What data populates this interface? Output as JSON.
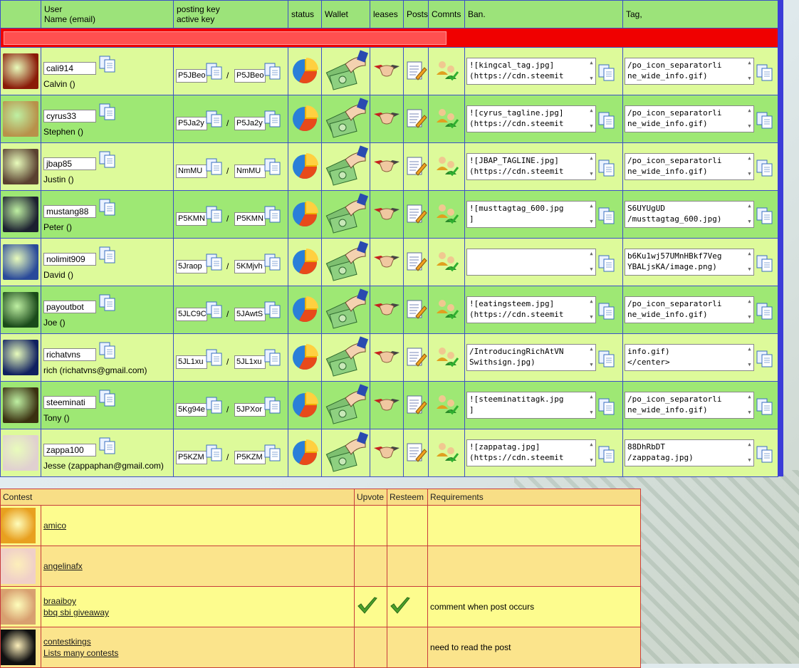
{
  "header": {
    "col_user_line1": "User",
    "col_user_line2": "Name (email)",
    "col_keys_line1": "posting key",
    "col_keys_line2": "active key",
    "col_status": "status",
    "col_wallet": "Wallet",
    "col_leases": "leases",
    "col_posts": "Posts",
    "col_comnts": "Comnts",
    "col_ban": "Ban.",
    "col_tag": "Tag,"
  },
  "slash": "/",
  "users": [
    {
      "username": "cali914",
      "name": "Calvin ()",
      "posting": "P5JBeo",
      "active": "P5JBeo",
      "ban": "![kingcal_tag.jpg]\n(https://cdn.steemit",
      "tag": "/po_icon_separatorli\nne_wide_info.gif)",
      "avatar_color": "#8a1a08"
    },
    {
      "username": "cyrus33",
      "name": "Stephen ()",
      "posting": "P5Ja2y",
      "active": "P5Ja2y",
      "ban": "![cyrus_tagline.jpg]\n(https://cdn.steemit",
      "tag": "/po_icon_separatorli\nne_wide_info.gif)",
      "avatar_color": "#b8914a"
    },
    {
      "username": "jbap85",
      "name": "Justin ()",
      "posting": "NmMU",
      "active": "NmMU",
      "ban": "![JBAP_TAGLINE.jpg]\n(https://cdn.steemit",
      "tag": "/po_icon_separatorli\nne_wide_info.gif)",
      "avatar_color": "#5a4030"
    },
    {
      "username": "mustang88",
      "name": "Peter ()",
      "posting": "P5KMN",
      "active": "P5KMN",
      "ban": "![musttagtag_600.jpg\n]",
      "tag": "S6UYUgUD\n/musttagtag_600.jpg)",
      "avatar_color": "#1c2030"
    },
    {
      "username": "nolimit909",
      "name": "David ()",
      "posting": "5Jraop",
      "active": "5KMjvh",
      "ban": "",
      "tag": "b6Ku1wj57UMnHBkf7Veg\nYBALjsKA/image.png)",
      "avatar_color": "#2a4a9a"
    },
    {
      "username": "payoutbot",
      "name": "Joe ()",
      "posting": "5JLC9C",
      "active": "5JAwtS",
      "ban": "![eatingsteem.jpg]\n(https://cdn.steemit",
      "tag": "/po_icon_separatorli\nne_wide_info.gif)",
      "avatar_color": "#1a4a1a"
    },
    {
      "username": "richatvns",
      "name": "rich (richatvns@gmail.com)",
      "posting": "5JL1xu",
      "active": "5JL1xu",
      "ban": "/IntroducingRichAtVN\nSwithsign.jpg)",
      "tag": "info.gif)\n</center>",
      "avatar_color": "#102060"
    },
    {
      "username": "steeminati",
      "name": "Tony ()",
      "posting": "5Kg94e",
      "active": "5JPXor",
      "ban": "![steeminatitagk.jpg\n]",
      "tag": "/po_icon_separatorli\nne_wide_info.gif)",
      "avatar_color": "#3a3010"
    },
    {
      "username": "zappa100",
      "name": "Jesse (zappaphan@gmail.com)",
      "posting": "P5KZM",
      "active": "P5KZM",
      "ban": "![zappatag.jpg]\n(https://cdn.steemit",
      "tag": "88DhRbDT\n/zappatag.jpg)",
      "avatar_color": "#e0d0d0"
    }
  ],
  "contest": {
    "col_contest": "Contest",
    "col_upvote": "Upvote",
    "col_resteem": "Resteem",
    "col_requirements": "Requirements",
    "rows": [
      {
        "name": "amico",
        "sub": "",
        "upvote": false,
        "resteem": false,
        "req": "",
        "avatar_color": "#e8a020"
      },
      {
        "name": "angelinafx",
        "sub": "",
        "upvote": false,
        "resteem": false,
        "req": "",
        "avatar_color": "#f0d0c8"
      },
      {
        "name": "braaiboy",
        "sub": "bbq sbi giveaway",
        "upvote": true,
        "resteem": true,
        "req": "comment when post occurs",
        "avatar_color": "#d8a070"
      },
      {
        "name": "contestkings",
        "sub": "Lists many contests",
        "upvote": false,
        "resteem": false,
        "req": "need to read the post",
        "avatar_color": "#101010"
      }
    ]
  },
  "colors": {
    "header_green": "#9ce37a",
    "row_light": "#ddfa9a",
    "row_green": "#9ee874",
    "grid_blue": "#3c50c8",
    "alert_red": "#f00000",
    "contest_yellow": "#fdfc8e"
  },
  "icons": [
    "copy-icon",
    "status-pie-icon",
    "wallet-money-icon",
    "handshake-icon",
    "posts-notepad-icon",
    "comments-users-icon",
    "checkmark-icon"
  ]
}
